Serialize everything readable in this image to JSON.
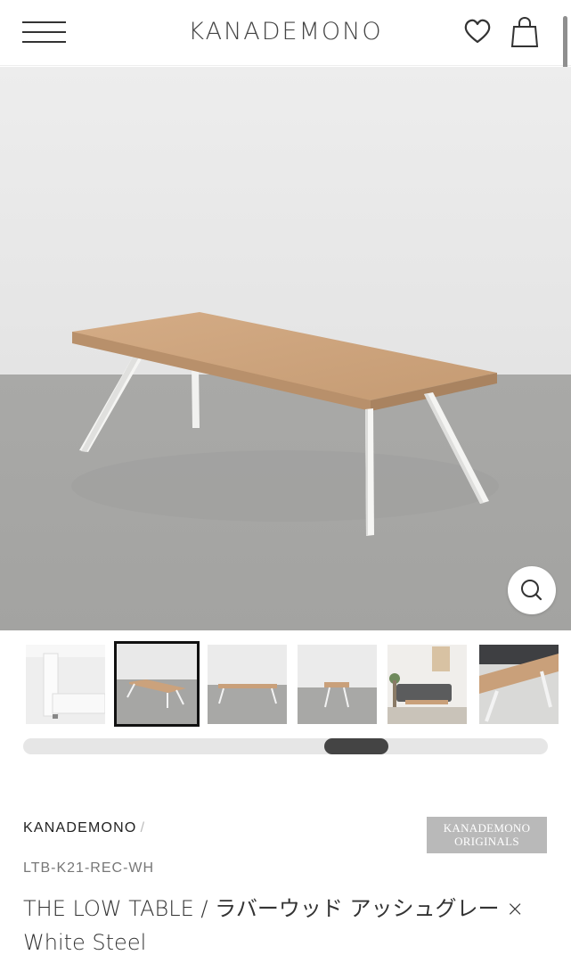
{
  "header": {
    "logo": "KANADEMONO",
    "menu_icon": "hamburger-menu-icon",
    "favorite_icon": "heart-icon",
    "cart_icon": "shopping-bag-icon"
  },
  "gallery": {
    "zoom_icon": "magnifier-icon",
    "thumbnail_count": 6,
    "active_thumbnail": 2,
    "scroll_position": 0.55
  },
  "product": {
    "brand": "KANADEMONO",
    "brand_separator": "/",
    "badge_line1": "KANADEMONO",
    "badge_line2": "ORIGINALS",
    "sku": "LTB-K21-REC-WH",
    "title": "THE LOW TABLE / ラバーウッド アッシュグレー × White Steel"
  },
  "colors": {
    "wood": "#c9a07a",
    "steel": "#f4f4f2",
    "floor": "#a7a7a5",
    "wall": "#e9e9e9",
    "badge": "#b9b9b9"
  }
}
